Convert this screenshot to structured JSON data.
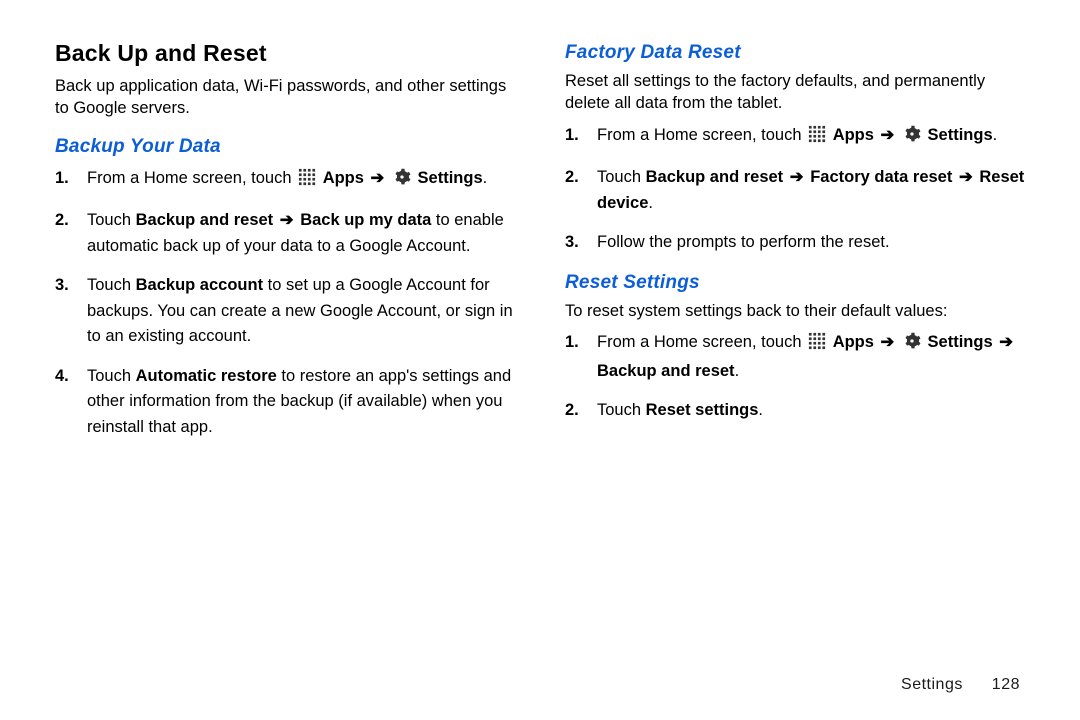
{
  "left": {
    "heading": "Back Up and Reset",
    "intro": "Back up application data, Wi-Fi passwords, and other settings to Google servers.",
    "sub": "Backup Your Data",
    "steps": {
      "s1a": "From a Home screen, touch",
      "s1_apps": "Apps",
      "s1_settings": "Settings",
      "s2a": "Touch ",
      "s2b": "Backup and reset",
      "s2c": " Back up my data",
      "s2d": " to enable automatic back up of your data to a Google Account.",
      "s3a": "Touch ",
      "s3b": "Backup account",
      "s3c": " to set up a Google Account for backups. You can create a new Google Account, or sign in to an existing account.",
      "s4a": "Touch ",
      "s4b": "Automatic restore",
      "s4c": " to restore an app's settings and other information from the backup (if available) when you reinstall that app."
    }
  },
  "right": {
    "sub1": "Factory Data Reset",
    "intro1": "Reset all settings to the factory defaults, and permanently delete all data from the tablet.",
    "f1a": "From a Home screen, touch",
    "f1_apps": "Apps",
    "f1_settings": "Settings",
    "f2a": "Touch ",
    "f2b": "Backup and reset",
    "f2c": " Factory data reset",
    "f2d": " Reset device",
    "f3": "Follow the prompts to perform the reset.",
    "sub2": "Reset Settings",
    "intro2": "To reset system settings back to their default values:",
    "r1a": "From a Home screen, touch",
    "r1_apps": "Apps",
    "r1_settings": "Settings",
    "r1_bar": " Backup and reset",
    "r2a": "Touch ",
    "r2b": "Reset settings"
  },
  "arrow": "➔",
  "dot": ".",
  "footer_label": "Settings",
  "footer_page": "128"
}
